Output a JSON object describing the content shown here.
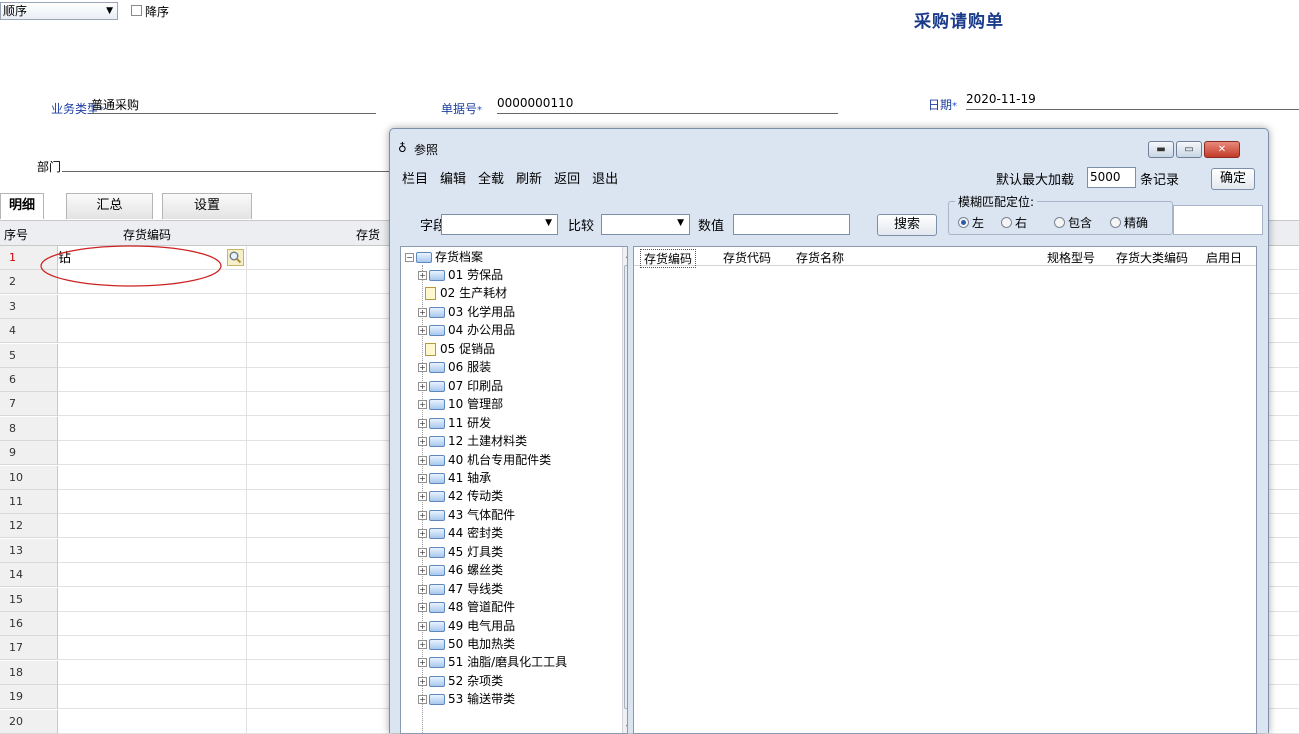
{
  "toolbar": {
    "sort_value": "顺序",
    "desc_label": "降序"
  },
  "title": "采购请购单",
  "header": {
    "biz_type_label": "业务类型",
    "biz_type_value": "普通采购",
    "doc_no_label": "单据号",
    "doc_no_value": "0000000110",
    "date_label": "日期",
    "date_value": "2020-11-19",
    "dept_label": "部门",
    "required_mark": "*"
  },
  "tabs": [
    "明细",
    "汇总",
    "设置"
  ],
  "grid": {
    "col_seq": "序号",
    "col_code": "存货编码",
    "col_next": "存货",
    "first_cell": "钻",
    "rows": [
      "1",
      "2",
      "3",
      "4",
      "5",
      "6",
      "7",
      "8",
      "9",
      "10",
      "11",
      "12",
      "13",
      "14",
      "15",
      "16",
      "17",
      "18",
      "19",
      "20"
    ]
  },
  "dialog": {
    "title": "参照",
    "menu": [
      "栏目",
      "编辑",
      "全载",
      "刷新",
      "返回",
      "退出"
    ],
    "max_load_label": "默认最大加载",
    "max_load_value": "5000",
    "records_label": "条记录",
    "confirm_label": "确定",
    "field_label": "字段",
    "compare_label": "比较",
    "value_label": "数值",
    "search_label": "搜索",
    "fuzzy_label": "模糊匹配定位:",
    "radios": [
      "左",
      "右",
      "包含",
      "精确"
    ],
    "selected_radio": "左",
    "tree_root": "存货档案",
    "tree_items": [
      {
        "label": "01 劳保品",
        "leaf": false
      },
      {
        "label": "02 生产耗材",
        "leaf": true
      },
      {
        "label": "03 化学用品",
        "leaf": false
      },
      {
        "label": "04 办公用品",
        "leaf": false
      },
      {
        "label": "05 促销品",
        "leaf": true
      },
      {
        "label": "06 服装",
        "leaf": false
      },
      {
        "label": "07 印刷品",
        "leaf": false
      },
      {
        "label": "10 管理部",
        "leaf": false
      },
      {
        "label": "11 研发",
        "leaf": false
      },
      {
        "label": "12 土建材料类",
        "leaf": false
      },
      {
        "label": "40 机台专用配件类",
        "leaf": false
      },
      {
        "label": "41 轴承",
        "leaf": false
      },
      {
        "label": "42 传动类",
        "leaf": false
      },
      {
        "label": "43 气体配件",
        "leaf": false
      },
      {
        "label": "44 密封类",
        "leaf": false
      },
      {
        "label": "45 灯具类",
        "leaf": false
      },
      {
        "label": "46 螺丝类",
        "leaf": false
      },
      {
        "label": "47 导线类",
        "leaf": false
      },
      {
        "label": "48 管道配件",
        "leaf": false
      },
      {
        "label": "49 电气用品",
        "leaf": false
      },
      {
        "label": "50 电加热类",
        "leaf": false
      },
      {
        "label": "51 油脂/磨具化工工具",
        "leaf": false
      },
      {
        "label": "52 杂项类",
        "leaf": false
      },
      {
        "label": "53 输送带类",
        "leaf": false
      }
    ],
    "list_columns": [
      "存货编码",
      "存货代码",
      "存货名称",
      "规格型号",
      "存货大类编码",
      "启用日"
    ]
  }
}
